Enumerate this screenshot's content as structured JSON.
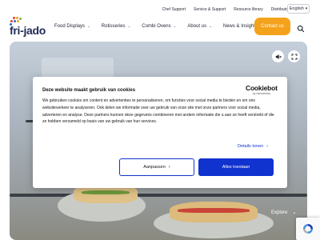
{
  "header": {
    "top_links": [
      "Chef Support",
      "Service & Support",
      "Resource library",
      "Distributors"
    ],
    "language": "English",
    "logo_text": "fri-jado",
    "nav": [
      {
        "label": "Food Displays",
        "has_menu": true
      },
      {
        "label": "Rotisseries",
        "has_menu": true
      },
      {
        "label": "Combi Ovens",
        "has_menu": true
      },
      {
        "label": "About us",
        "has_menu": true
      },
      {
        "label": "News & Insights",
        "has_menu": false
      }
    ],
    "contact_label": "Contact us",
    "search_icon": "search-icon"
  },
  "hero": {
    "explore_label": "Explore",
    "controls": [
      "mute-icon",
      "fullscreen-icon"
    ]
  },
  "cookie_banner": {
    "title": "Deze website maakt gebruik van cookies",
    "body": "We gebruiken cookies om content en advertenties te personaliseren, om functies voor social media te bieden en om ons websiteverkeer te analyseren. Ook delen we informatie over uw gebruik van onze site met onze partners voor social media, adverteren en analyse. Deze partners kunnen deze gegevens combineren met andere informatie die u aan ze heeft verstrekt of die ze hebben verzameld op basis van uw gebruik van hun services.",
    "brand": "Cookiebot",
    "brand_sub": "by Usercentrics",
    "details_label": "Details tonen",
    "customize_label": "Aanpassen",
    "accept_label": "Alles toestaan"
  },
  "colors": {
    "brand_navy": "#1f2a55",
    "accent_orange": "#f4a21c",
    "cookie_blue": "#1032cf"
  }
}
